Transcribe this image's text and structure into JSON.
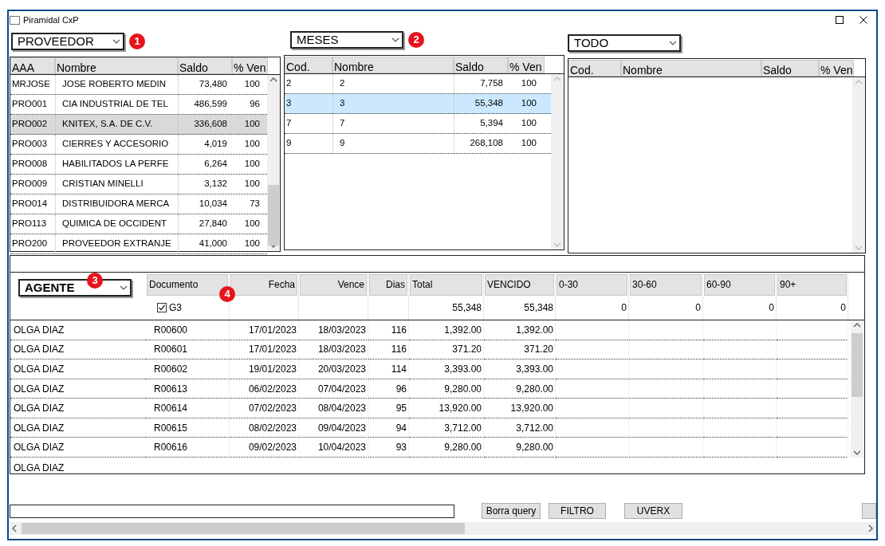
{
  "window": {
    "title": "Piramidal CxP"
  },
  "panels": [
    {
      "dropdown": "PROVEEDOR",
      "badge": "1",
      "focused": false,
      "columns": [
        "AAA",
        "Nombre",
        "Saldo",
        "% Ven"
      ],
      "rows": [
        {
          "cells": [
            "MRJOSE",
            "JOSE ROBERTO MEDIN",
            "73,480",
            "100"
          ],
          "selected": false
        },
        {
          "cells": [
            "PRO001",
            "CIA INDUSTRIAL DE TEL",
            "486,599",
            "96"
          ],
          "selected": false
        },
        {
          "cells": [
            "PRO002",
            "KNITEX, S.A. DE C.V.",
            "336,608",
            "100"
          ],
          "selected": true
        },
        {
          "cells": [
            "PRO003",
            "CIERRES Y ACCESORIO",
            "4,019",
            "100"
          ],
          "selected": false
        },
        {
          "cells": [
            "PRO008",
            "HABILITADOS LA PERFE",
            "6,264",
            "100"
          ],
          "selected": false
        },
        {
          "cells": [
            "PRO009",
            "CRISTIAN MINELLI",
            "3,132",
            "100"
          ],
          "selected": false
        },
        {
          "cells": [
            "PRO014",
            "DISTRIBUIDORA MERCA",
            "10,034",
            "73"
          ],
          "selected": false
        },
        {
          "cells": [
            "PRO113",
            "QUIMICA DE OCCIDENT",
            "27,840",
            "100"
          ],
          "selected": false
        },
        {
          "cells": [
            "PRO200",
            "PROVEEDOR EXTRANJE",
            "41,000",
            "100"
          ],
          "selected": false
        }
      ]
    },
    {
      "dropdown": "MESES",
      "badge": "2",
      "focused": true,
      "columns": [
        "Cod.",
        "Nombre",
        "Saldo",
        "% Ven"
      ],
      "rows": [
        {
          "cells": [
            "2",
            "2",
            "7,758",
            "100"
          ],
          "selected": false
        },
        {
          "cells": [
            "3",
            "3",
            "55,348",
            "100"
          ],
          "selected": true
        },
        {
          "cells": [
            "7",
            "7",
            "5,394",
            "100"
          ],
          "selected": false
        },
        {
          "cells": [
            "9",
            "9",
            "268,108",
            "100"
          ],
          "selected": false
        }
      ]
    },
    {
      "dropdown": "TODO",
      "columns": [
        "Cod.",
        "Nombre",
        "Saldo",
        "% Ven"
      ]
    }
  ],
  "detail": {
    "group_dropdown": "AGENTE",
    "badge_group": "3",
    "badge_columns": "4",
    "columns": [
      "Documento",
      "Fecha",
      "Vence",
      "Dias",
      "Total",
      "VENCIDO",
      "0-30",
      "30-60",
      "60-90",
      "90+"
    ],
    "filter_checkbox": {
      "label": "G3",
      "checked": true
    },
    "totals": [
      "55,348",
      "55,348",
      "0",
      "0",
      "0",
      "0"
    ],
    "rows": [
      {
        "agent": "OLGA DIAZ",
        "cells": [
          "R00600",
          "17/01/2023",
          "18/03/2023",
          "116",
          "1,392.00",
          "1,392.00"
        ]
      },
      {
        "agent": "OLGA DIAZ",
        "cells": [
          "R00601",
          "17/01/2023",
          "18/03/2023",
          "116",
          "371.20",
          "371.20"
        ]
      },
      {
        "agent": "OLGA DIAZ",
        "cells": [
          "R00602",
          "19/01/2023",
          "20/03/2023",
          "114",
          "3,393.00",
          "3,393.00"
        ]
      },
      {
        "agent": "OLGA DIAZ",
        "cells": [
          "R00613",
          "06/02/2023",
          "07/04/2023",
          "96",
          "9,280.00",
          "9,280.00"
        ]
      },
      {
        "agent": "OLGA DIAZ",
        "cells": [
          "R00614",
          "07/02/2023",
          "08/04/2023",
          "95",
          "13,920.00",
          "13,920.00"
        ]
      },
      {
        "agent": "OLGA DIAZ",
        "cells": [
          "R00615",
          "08/02/2023",
          "09/04/2023",
          "94",
          "3,712.00",
          "3,712.00"
        ]
      },
      {
        "agent": "OLGA DIAZ",
        "cells": [
          "R00616",
          "09/02/2023",
          "10/04/2023",
          "93",
          "9,280.00",
          "9,280.00"
        ]
      }
    ],
    "last_agent": "OLGA DIAZ"
  },
  "footer": {
    "buttons": [
      "Borra query",
      "FILTRO",
      "UVERX"
    ]
  }
}
